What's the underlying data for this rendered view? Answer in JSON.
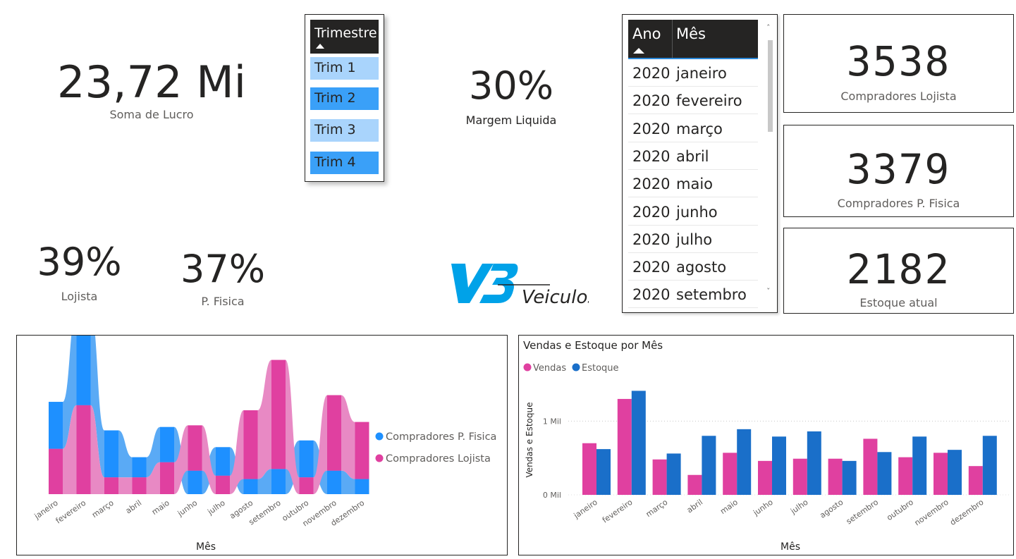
{
  "kpis": {
    "lucro": {
      "value": "23,72 Mi",
      "label": "Soma de Lucro"
    },
    "margem": {
      "value": "30%",
      "label": "Margem Liquida"
    },
    "lojista": {
      "value": "39%",
      "label": "Lojista"
    },
    "pfisica": {
      "value": "37%",
      "label": "P. Fisica"
    }
  },
  "slicer_trimestre": {
    "header": "Trimestre",
    "items": [
      "Trim 1",
      "Trim 2",
      "Trim 3",
      "Trim 4"
    ]
  },
  "slicer_mes": {
    "col_ano": "Ano",
    "col_mes": "Mês",
    "rows": [
      {
        "ano": "2020",
        "mes": "janeiro"
      },
      {
        "ano": "2020",
        "mes": "fevereiro"
      },
      {
        "ano": "2020",
        "mes": "março"
      },
      {
        "ano": "2020",
        "mes": "abril"
      },
      {
        "ano": "2020",
        "mes": "maio"
      },
      {
        "ano": "2020",
        "mes": "junho"
      },
      {
        "ano": "2020",
        "mes": "julho"
      },
      {
        "ano": "2020",
        "mes": "agosto"
      },
      {
        "ano": "2020",
        "mes": "setembro"
      }
    ]
  },
  "cards": [
    {
      "value": "3538",
      "label": "Compradores Lojista"
    },
    {
      "value": "3379",
      "label": "Compradores P. Fisica"
    },
    {
      "value": "2182",
      "label": "Estoque atual"
    }
  ],
  "logo": {
    "text": "Veiculos",
    "color": "#00a2e8"
  },
  "colors": {
    "pink": "#e040a0",
    "blue": "#1e90ff",
    "darkblue": "#1a6fc9",
    "pinklight": "#e889c4",
    "bluelight": "#5aaaf5"
  },
  "chart_data": [
    {
      "type": "area",
      "title": "",
      "xlabel": "Mês",
      "categories": [
        "janeiro",
        "fevereiro",
        "março",
        "abril",
        "maio",
        "junho",
        "julho",
        "agosto",
        "setembro",
        "outubro",
        "novembro",
        "dezembro"
      ],
      "series": [
        {
          "name": "Compradores P. Fisica",
          "values": [
            280,
            560,
            280,
            120,
            210,
            140,
            170,
            90,
            150,
            220,
            140,
            90
          ]
        },
        {
          "name": "Compradores Lojista",
          "values": [
            270,
            530,
            100,
            100,
            190,
            270,
            110,
            410,
            650,
            100,
            450,
            340
          ]
        }
      ],
      "legend": "right"
    },
    {
      "type": "bar",
      "title": "Vendas e Estoque por Mês",
      "xlabel": "Mês",
      "ylabel": "Vendas e Estoque",
      "yticks": [
        "0 Mil",
        "1 Mil"
      ],
      "ylim": [
        0,
        1500
      ],
      "categories": [
        "janeiro",
        "fevereiro",
        "março",
        "abril",
        "maio",
        "junho",
        "julho",
        "agosto",
        "setembro",
        "outubro",
        "novembro",
        "dezembro"
      ],
      "series": [
        {
          "name": "Vendas",
          "values": [
            700,
            1300,
            480,
            270,
            570,
            460,
            490,
            490,
            760,
            510,
            570,
            390
          ]
        },
        {
          "name": "Estoque",
          "values": [
            620,
            1410,
            560,
            800,
            890,
            790,
            860,
            460,
            580,
            790,
            610,
            800
          ]
        }
      ],
      "legend": "top-left"
    }
  ]
}
